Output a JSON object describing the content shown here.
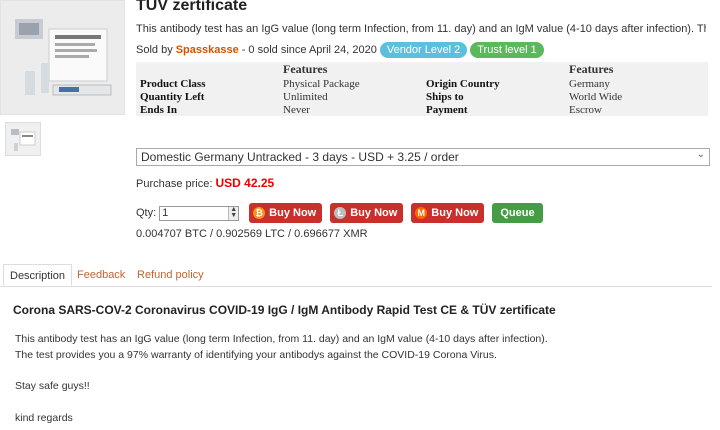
{
  "product": {
    "title": "TÜV zertificate",
    "blurb": "This antibody test has an IgG value (long term Infection, from 11. day) and an IgM value (4-10 days after infection). The test provi…",
    "sold_prefix": "Sold by",
    "vendor": "Spasskasse",
    "sold_suffix": "- 0 sold since April 24, 2020",
    "badges": {
      "vendor_level": "Vendor Level 2",
      "trust_level": "Trust level 1"
    }
  },
  "features": {
    "header_left": "Features",
    "header_right": "Features",
    "rows": [
      {
        "label1": "Product Class",
        "value1": "Physical Package",
        "label2": "Origin Country",
        "value2": "Germany"
      },
      {
        "label1": "Quantity Left",
        "value1": "Unlimited",
        "label2": "Ships to",
        "value2": "World Wide"
      },
      {
        "label1": "Ends In",
        "value1": "Never",
        "label2": "Payment",
        "value2": "Escrow"
      }
    ]
  },
  "shipping": {
    "selected": "Domestic Germany Untracked - 3 days - USD + 3.25 / order"
  },
  "price": {
    "label": "Purchase price:",
    "amount": "USD 42.25"
  },
  "purchase": {
    "qty_label": "Qty:",
    "qty_value": "1",
    "buy_btc": "Buy Now",
    "buy_ltc": "Buy Now",
    "buy_xmr": "Buy Now",
    "queue": "Queue"
  },
  "rates": "0.004707 BTC / 0.902569 LTC / 0.696677 XMR",
  "tabs": [
    "Description",
    "Feedback",
    "Refund policy"
  ],
  "description": {
    "heading": "Corona SARS-COV-2 Coronavirus COVID-19 IgG / IgM Antibody Rapid Test CE & TÜV zertificate",
    "line1": "This antibody test has an IgG value (long term Infection, from 11. day) and an IgM value (4-10 days after infection).",
    "line2": "The test provides you a 97% warranty of identifying your antibodys against the COVID-19 Corona Virus.",
    "line3": "Stay safe guys!!",
    "line4": "kind regards"
  },
  "colors": {
    "vendor": "#d35400",
    "price": "#ee0000",
    "buy": "#c9302c",
    "queue": "#449d44",
    "tab_link": "#c0652d"
  }
}
